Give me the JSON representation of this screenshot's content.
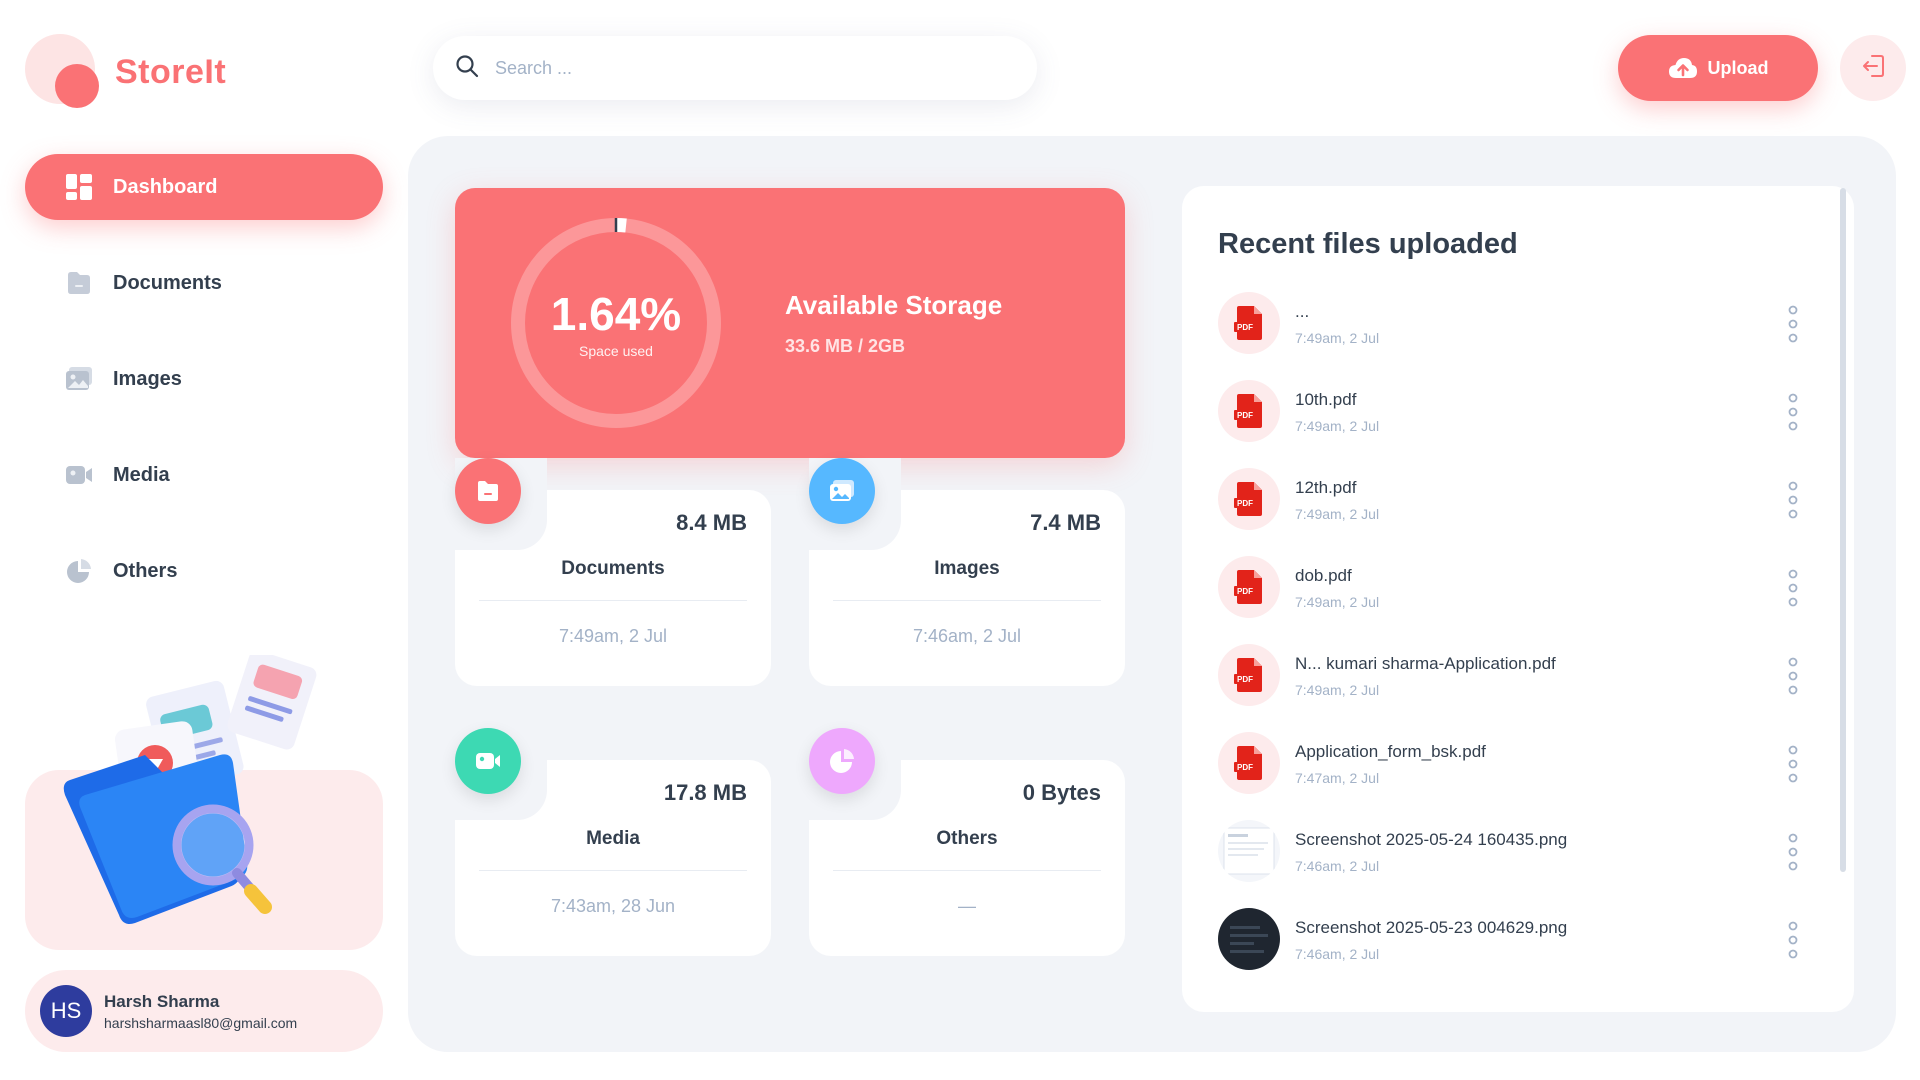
{
  "app": {
    "name": "StoreIt"
  },
  "colors": {
    "brand": "#FA7275",
    "brand_light": "#FDEBEC",
    "text": "#333F4E",
    "muted": "#A3B2C7",
    "documents": "#FA7275",
    "images": "#56B8FF",
    "media": "#3DD9B3",
    "others": "#EEA8FD"
  },
  "sidebar": {
    "items": [
      {
        "label": "Dashboard",
        "icon": "dashboard-icon",
        "active": true
      },
      {
        "label": "Documents",
        "icon": "folder-icon",
        "active": false
      },
      {
        "label": "Images",
        "icon": "image-icon",
        "active": false
      },
      {
        "label": "Media",
        "icon": "video-icon",
        "active": false
      },
      {
        "label": "Others",
        "icon": "pie-chart-icon",
        "active": false
      }
    ]
  },
  "user": {
    "initials": "HS",
    "name": "Harsh Sharma",
    "email": "harshsharmaasl80@gmail.com"
  },
  "header": {
    "search_placeholder": "Search ...",
    "upload_label": "Upload"
  },
  "storage": {
    "percent_label": "1.64%",
    "percent_value": 1.64,
    "sub_label": "Space used",
    "title": "Available Storage",
    "value": "33.6 MB / 2GB"
  },
  "summary": [
    {
      "label": "Documents",
      "size": "8.4 MB",
      "date": "7:49am, 2 Jul",
      "icon": "document-icon"
    },
    {
      "label": "Images",
      "size": "7.4 MB",
      "date": "7:46am, 2 Jul",
      "icon": "image-icon"
    },
    {
      "label": "Media",
      "size": "17.8 MB",
      "date": "7:43am, 28 Jun",
      "icon": "video-icon"
    },
    {
      "label": "Others",
      "size": "0 Bytes",
      "date": "—",
      "icon": "pie-chart-icon"
    }
  ],
  "recent": {
    "title": "Recent files uploaded",
    "files": [
      {
        "name": "...",
        "time": "7:49am, 2 Jul",
        "type": "pdf"
      },
      {
        "name": "10th.pdf",
        "time": "7:49am, 2 Jul",
        "type": "pdf"
      },
      {
        "name": "12th.pdf",
        "time": "7:49am, 2 Jul",
        "type": "pdf"
      },
      {
        "name": "dob.pdf",
        "time": "7:49am, 2 Jul",
        "type": "pdf"
      },
      {
        "name": "N... kumari sharma-Application.pdf",
        "time": "7:49am, 2 Jul",
        "type": "pdf"
      },
      {
        "name": "Application_form_bsk.pdf",
        "time": "7:47am, 2 Jul",
        "type": "pdf"
      },
      {
        "name": "Screenshot 2025-05-24 160435.png",
        "time": "7:46am, 2 Jul",
        "type": "image-light"
      },
      {
        "name": "Screenshot 2025-05-23 004629.png",
        "time": "7:46am, 2 Jul",
        "type": "image-dark"
      }
    ]
  }
}
